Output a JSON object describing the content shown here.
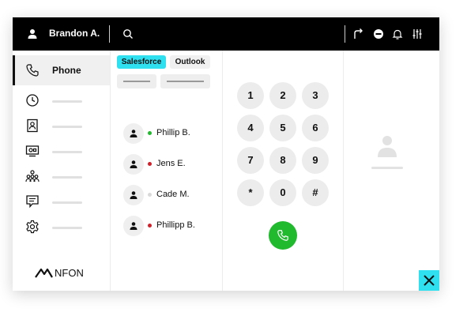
{
  "topbar": {
    "user_name": "Brandon A.",
    "icons": [
      "user-icon",
      "search-icon",
      "call-forward-icon",
      "do-not-disturb-icon",
      "bell-icon",
      "settings-sliders-icon"
    ]
  },
  "sidebar": {
    "items": [
      {
        "label": "Phone",
        "icon": "phone-icon"
      },
      {
        "label": "",
        "icon": "clock-icon"
      },
      {
        "label": "",
        "icon": "contact-card-icon"
      },
      {
        "label": "",
        "icon": "video-icon"
      },
      {
        "label": "",
        "icon": "group-icon"
      },
      {
        "label": "",
        "icon": "chat-icon"
      },
      {
        "label": "",
        "icon": "gear-icon"
      }
    ],
    "logo_text": "NFON"
  },
  "contacts": {
    "tabs": [
      {
        "label": "Salesforce",
        "color": "#2ee0f0"
      },
      {
        "label": "Outlook",
        "color": "#f0f0f0"
      }
    ],
    "list": [
      {
        "name": "Phillip B.",
        "status_color": "#21b92d"
      },
      {
        "name": "Jens E.",
        "status_color": "#d0202a"
      },
      {
        "name": "Cade M.",
        "status_color": "#d9d9d9"
      },
      {
        "name": "Phillipp B.",
        "status_color": "#d0202a"
      }
    ]
  },
  "dialer": {
    "keys": [
      "1",
      "2",
      "3",
      "4",
      "5",
      "6",
      "7",
      "8",
      "9",
      "*",
      "0",
      "#"
    ],
    "call_color": "#21b92d"
  },
  "accent_color": "#2ee0f0"
}
